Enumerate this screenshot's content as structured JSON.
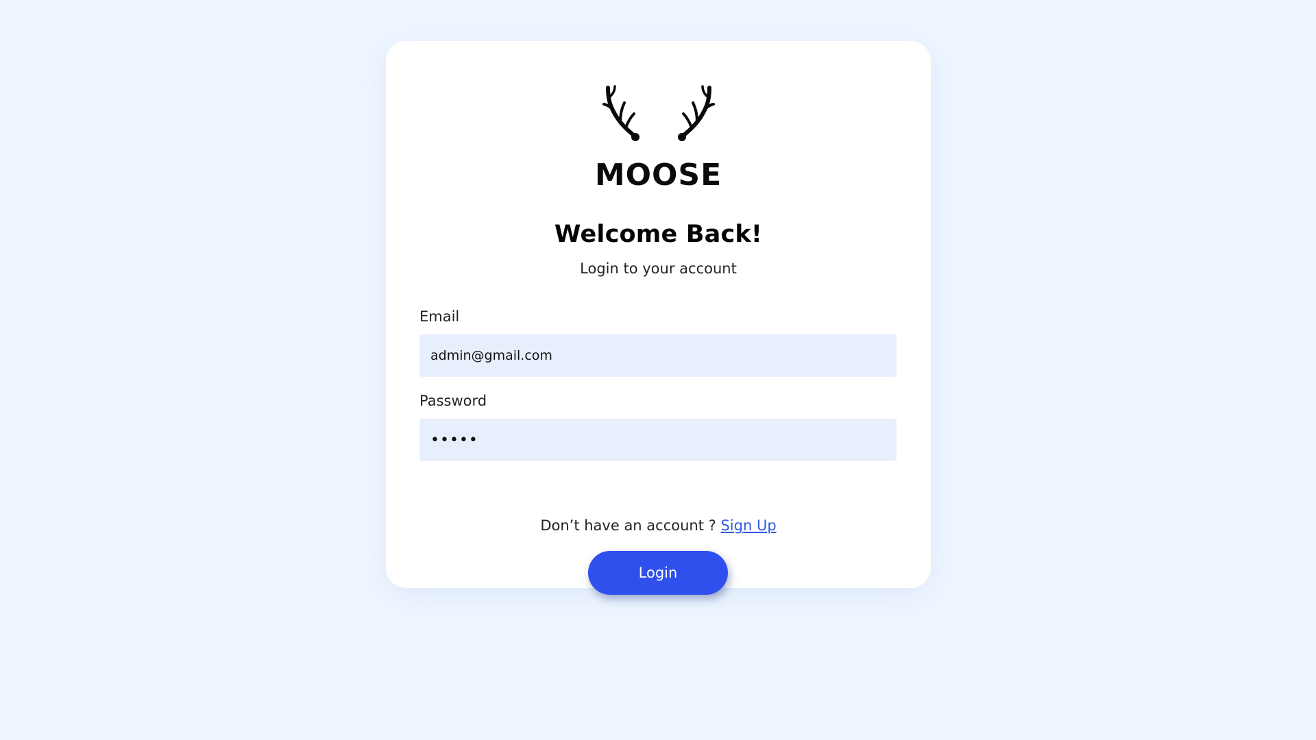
{
  "brand": {
    "logo_text": "MOOSE",
    "logo_icon": "moose-antlers-icon"
  },
  "header": {
    "title": "Welcome Back!",
    "subtitle": "Login to your account"
  },
  "form": {
    "email_label": "Email",
    "email_value": "admin@gmail.com",
    "password_label": "Password",
    "password_value": "admin"
  },
  "footer": {
    "signup_prompt": "Don’t have an account ? ",
    "signup_link": "Sign Up",
    "login_button": "Login"
  },
  "colors": {
    "background": "#eff6ff",
    "input_background": "#e8effc",
    "primary_button": "#3050ee",
    "link": "#2f5be0"
  }
}
